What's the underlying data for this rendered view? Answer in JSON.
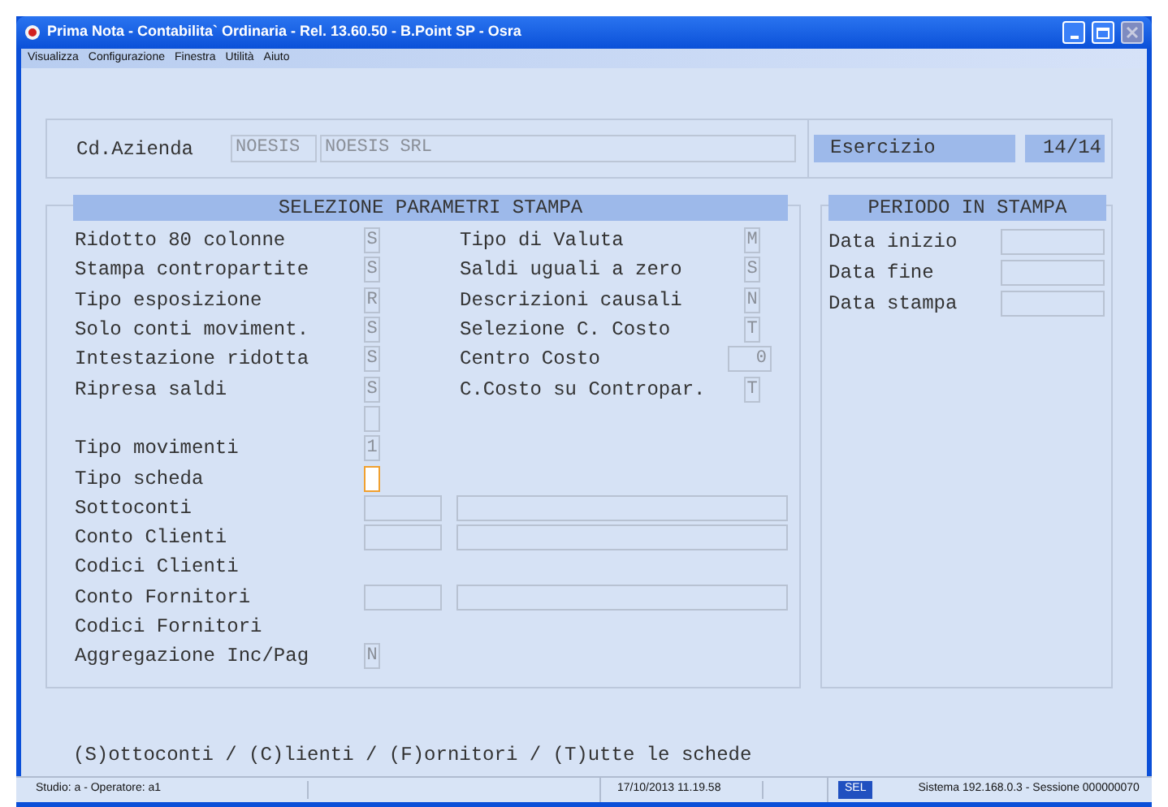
{
  "window": {
    "title": "Prima Nota - Contabilita` Ordinaria - Rel. 13.60.50 - B.Point SP - Osra"
  },
  "menu": [
    "Visualizza",
    "Configurazione",
    "Finestra",
    "Utilità",
    "Aiuto"
  ],
  "company": {
    "label": "Cd.Azienda",
    "code": "NOESIS",
    "name": "NOESIS SRL",
    "year_label": "Esercizio",
    "year": "14/14"
  },
  "params": {
    "title": "SELEZIONE PARAMETRI STAMPA",
    "left": [
      {
        "label": "Ridotto 80 colonne",
        "value": "S"
      },
      {
        "label": "Stampa contropartite",
        "value": "S"
      },
      {
        "label": "Tipo esposizione",
        "value": "R"
      },
      {
        "label": "Solo conti moviment.",
        "value": "S"
      },
      {
        "label": "Intestazione ridotta",
        "value": "S"
      },
      {
        "label": "Ripresa saldi",
        "value": "S"
      }
    ],
    "right": [
      {
        "label": "Tipo di Valuta",
        "value": "M",
        "kind": "flag"
      },
      {
        "label": "Saldi uguali a zero",
        "value": "S",
        "kind": "flag"
      },
      {
        "label": "Descrizioni causali",
        "value": "N",
        "kind": "flag"
      },
      {
        "label": "Selezione C. Costo",
        "value": "T",
        "kind": "flag"
      },
      {
        "label": "Centro Costo",
        "value": "0",
        "kind": "number"
      },
      {
        "label": "C.Costo su Contropar.",
        "value": "T",
        "kind": "flag"
      }
    ],
    "lower": [
      {
        "kind": "blank",
        "focused": false
      },
      {
        "kind": "flag",
        "label": "Tipo movimenti",
        "value": "1",
        "focused": false
      },
      {
        "kind": "flag",
        "label": "Tipo scheda",
        "focused": true
      },
      {
        "kind": "range",
        "label": "Sottoconti"
      },
      {
        "kind": "range",
        "label": "Conto Clienti"
      },
      {
        "kind": "plain",
        "label": "Codici Clienti"
      },
      {
        "kind": "range",
        "label": "Conto Fornitori"
      },
      {
        "kind": "plain",
        "label": "Codici Fornitori"
      },
      {
        "kind": "flag",
        "label": "Aggregazione Inc/Pag",
        "value": "N",
        "focused": false
      }
    ]
  },
  "period": {
    "title": "PERIODO IN STAMPA",
    "items": [
      {
        "label": "Data inizio"
      },
      {
        "label": "Data fine"
      },
      {
        "label": "Data stampa"
      }
    ]
  },
  "hint": "(S)ottoconti / (C)lienti / (F)ornitori / (T)utte le schede",
  "status_bar": {
    "user": "Studio: a - Operatore: a1",
    "datetime": "17/10/2013  11.19.58",
    "mode": "SEL",
    "system": "Sistema 192.168.0.3 - Sessione 000000070"
  }
}
